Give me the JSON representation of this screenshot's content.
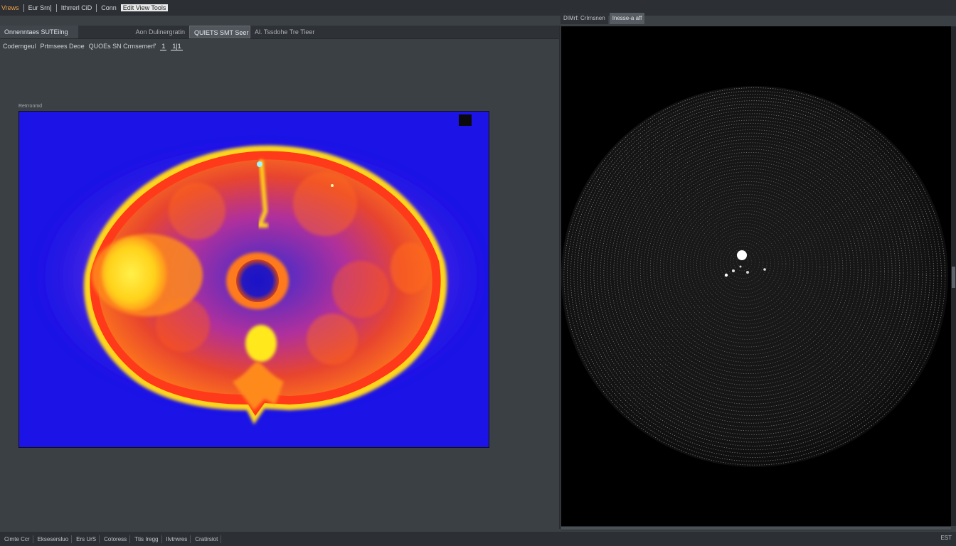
{
  "menubar": {
    "items": [
      "Vrews",
      "Eur Srn]",
      "Ithrrerl CiD",
      "Conn"
    ],
    "boxed_item": "Edit View Tools"
  },
  "tabs": {
    "t1": "Onnenntaes SUTEilng",
    "t2": "Aon Dulinergratin",
    "t3": "QUIETS SMT Seer",
    "t4": "Al. Tssdohe Tre Tieer"
  },
  "toolbar": {
    "items": [
      "Coderngeul",
      "Prtmsees Deoe",
      "QUOEs SN Crmsemerf'"
    ],
    "button1": "1",
    "button2": "1|1"
  },
  "left_panel": {
    "label": "Retrronmd"
  },
  "right_tabs": {
    "tab1": "DIMrf: Crlrnsnen",
    "tab2": "Inesse-a aff"
  },
  "statusbar": {
    "items": [
      "Cimte Ccr",
      "Eksesersluo",
      "Ers UrS",
      "Cotoress",
      "Ttis Iregg",
      "Ilvtrwres",
      "Cratirsiot"
    ],
    "right": "EST"
  },
  "colors": {
    "left_background": "#1c14e6",
    "heat_hot": "#ffe81a",
    "heat_mid": "#ff5a1a",
    "heat_cool": "#c02a9a",
    "right_background": "#000000"
  },
  "icons": {
    "tab_icon": "pin-icon"
  }
}
